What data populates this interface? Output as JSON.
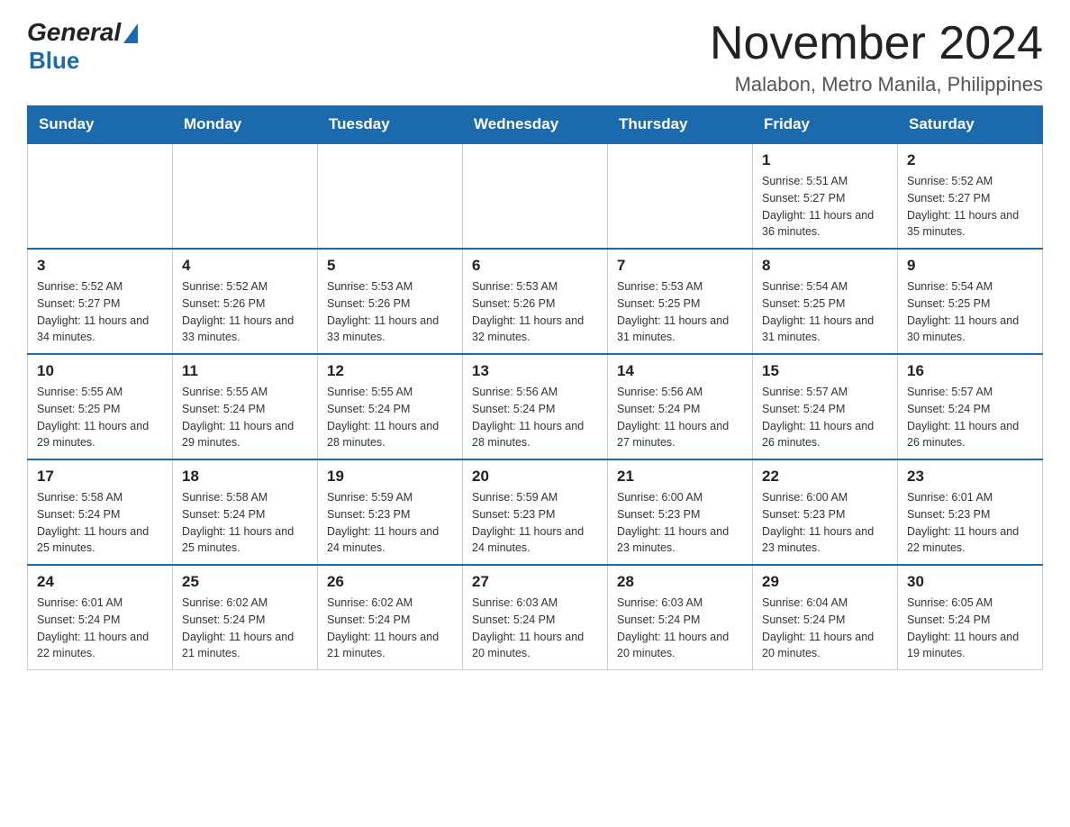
{
  "header": {
    "logo_general": "General",
    "logo_blue": "Blue",
    "title": "November 2024",
    "subtitle": "Malabon, Metro Manila, Philippines"
  },
  "days_of_week": [
    "Sunday",
    "Monday",
    "Tuesday",
    "Wednesday",
    "Thursday",
    "Friday",
    "Saturday"
  ],
  "weeks": [
    {
      "days": [
        {
          "number": "",
          "info": ""
        },
        {
          "number": "",
          "info": ""
        },
        {
          "number": "",
          "info": ""
        },
        {
          "number": "",
          "info": ""
        },
        {
          "number": "",
          "info": ""
        },
        {
          "number": "1",
          "info": "Sunrise: 5:51 AM\nSunset: 5:27 PM\nDaylight: 11 hours and 36 minutes."
        },
        {
          "number": "2",
          "info": "Sunrise: 5:52 AM\nSunset: 5:27 PM\nDaylight: 11 hours and 35 minutes."
        }
      ]
    },
    {
      "days": [
        {
          "number": "3",
          "info": "Sunrise: 5:52 AM\nSunset: 5:27 PM\nDaylight: 11 hours and 34 minutes."
        },
        {
          "number": "4",
          "info": "Sunrise: 5:52 AM\nSunset: 5:26 PM\nDaylight: 11 hours and 33 minutes."
        },
        {
          "number": "5",
          "info": "Sunrise: 5:53 AM\nSunset: 5:26 PM\nDaylight: 11 hours and 33 minutes."
        },
        {
          "number": "6",
          "info": "Sunrise: 5:53 AM\nSunset: 5:26 PM\nDaylight: 11 hours and 32 minutes."
        },
        {
          "number": "7",
          "info": "Sunrise: 5:53 AM\nSunset: 5:25 PM\nDaylight: 11 hours and 31 minutes."
        },
        {
          "number": "8",
          "info": "Sunrise: 5:54 AM\nSunset: 5:25 PM\nDaylight: 11 hours and 31 minutes."
        },
        {
          "number": "9",
          "info": "Sunrise: 5:54 AM\nSunset: 5:25 PM\nDaylight: 11 hours and 30 minutes."
        }
      ]
    },
    {
      "days": [
        {
          "number": "10",
          "info": "Sunrise: 5:55 AM\nSunset: 5:25 PM\nDaylight: 11 hours and 29 minutes."
        },
        {
          "number": "11",
          "info": "Sunrise: 5:55 AM\nSunset: 5:24 PM\nDaylight: 11 hours and 29 minutes."
        },
        {
          "number": "12",
          "info": "Sunrise: 5:55 AM\nSunset: 5:24 PM\nDaylight: 11 hours and 28 minutes."
        },
        {
          "number": "13",
          "info": "Sunrise: 5:56 AM\nSunset: 5:24 PM\nDaylight: 11 hours and 28 minutes."
        },
        {
          "number": "14",
          "info": "Sunrise: 5:56 AM\nSunset: 5:24 PM\nDaylight: 11 hours and 27 minutes."
        },
        {
          "number": "15",
          "info": "Sunrise: 5:57 AM\nSunset: 5:24 PM\nDaylight: 11 hours and 26 minutes."
        },
        {
          "number": "16",
          "info": "Sunrise: 5:57 AM\nSunset: 5:24 PM\nDaylight: 11 hours and 26 minutes."
        }
      ]
    },
    {
      "days": [
        {
          "number": "17",
          "info": "Sunrise: 5:58 AM\nSunset: 5:24 PM\nDaylight: 11 hours and 25 minutes."
        },
        {
          "number": "18",
          "info": "Sunrise: 5:58 AM\nSunset: 5:24 PM\nDaylight: 11 hours and 25 minutes."
        },
        {
          "number": "19",
          "info": "Sunrise: 5:59 AM\nSunset: 5:23 PM\nDaylight: 11 hours and 24 minutes."
        },
        {
          "number": "20",
          "info": "Sunrise: 5:59 AM\nSunset: 5:23 PM\nDaylight: 11 hours and 24 minutes."
        },
        {
          "number": "21",
          "info": "Sunrise: 6:00 AM\nSunset: 5:23 PM\nDaylight: 11 hours and 23 minutes."
        },
        {
          "number": "22",
          "info": "Sunrise: 6:00 AM\nSunset: 5:23 PM\nDaylight: 11 hours and 23 minutes."
        },
        {
          "number": "23",
          "info": "Sunrise: 6:01 AM\nSunset: 5:23 PM\nDaylight: 11 hours and 22 minutes."
        }
      ]
    },
    {
      "days": [
        {
          "number": "24",
          "info": "Sunrise: 6:01 AM\nSunset: 5:24 PM\nDaylight: 11 hours and 22 minutes."
        },
        {
          "number": "25",
          "info": "Sunrise: 6:02 AM\nSunset: 5:24 PM\nDaylight: 11 hours and 21 minutes."
        },
        {
          "number": "26",
          "info": "Sunrise: 6:02 AM\nSunset: 5:24 PM\nDaylight: 11 hours and 21 minutes."
        },
        {
          "number": "27",
          "info": "Sunrise: 6:03 AM\nSunset: 5:24 PM\nDaylight: 11 hours and 20 minutes."
        },
        {
          "number": "28",
          "info": "Sunrise: 6:03 AM\nSunset: 5:24 PM\nDaylight: 11 hours and 20 minutes."
        },
        {
          "number": "29",
          "info": "Sunrise: 6:04 AM\nSunset: 5:24 PM\nDaylight: 11 hours and 20 minutes."
        },
        {
          "number": "30",
          "info": "Sunrise: 6:05 AM\nSunset: 5:24 PM\nDaylight: 11 hours and 19 minutes."
        }
      ]
    }
  ]
}
